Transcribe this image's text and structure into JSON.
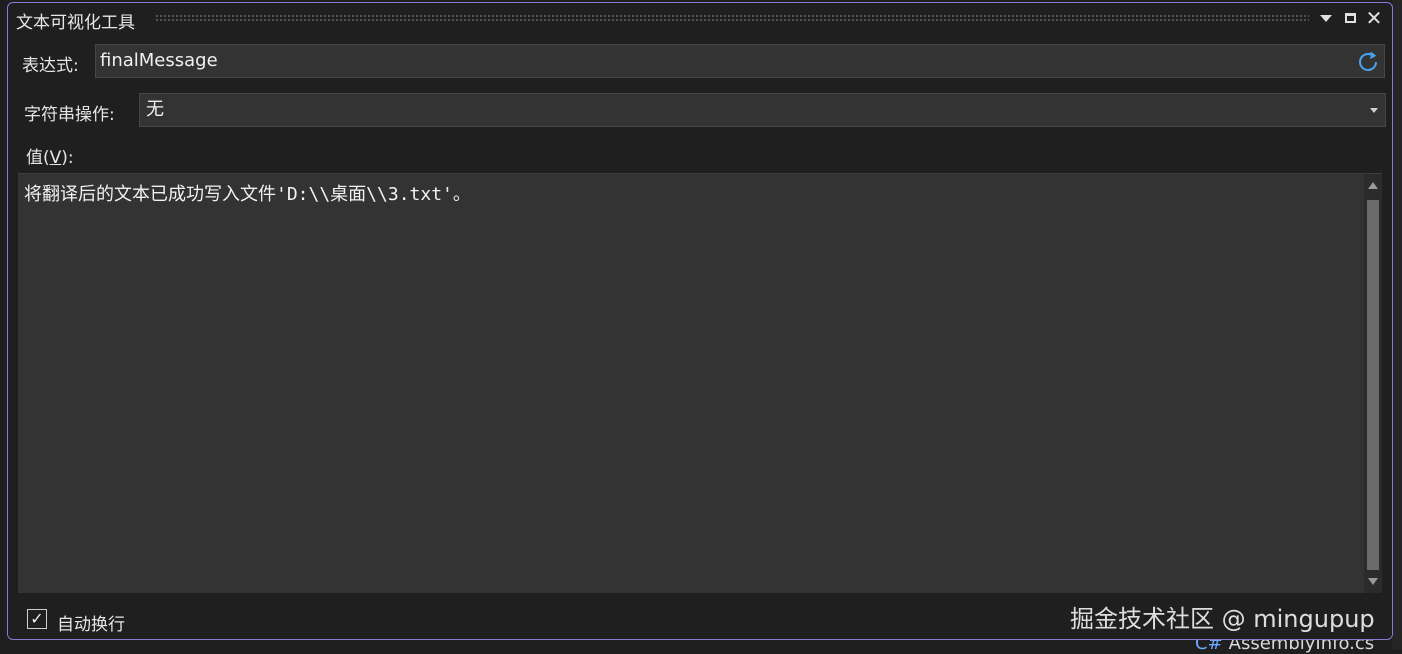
{
  "window": {
    "title": "文本可视化工具"
  },
  "titlebar_icons": [
    "dropdown-icon",
    "maximize-icon",
    "close-icon"
  ],
  "expression": {
    "label": "表达式:",
    "value": "finalMessage"
  },
  "string_ops": {
    "label": "字符串操作:",
    "selected": "无"
  },
  "value": {
    "label_prefix": "值(",
    "label_key": "V",
    "label_suffix": "):",
    "text": "将翻译后的文本已成功写入文件'D:\\\\桌面\\\\3.txt'。"
  },
  "word_wrap": {
    "label": "自动换行",
    "checked": true
  },
  "watermark": "掘金技术社区 @ mingupup",
  "background": {
    "file_label": "AssemblyInfo.cs"
  },
  "colors": {
    "window_border": "#8a7ad6",
    "refresh_icon": "#4aa3f0"
  }
}
